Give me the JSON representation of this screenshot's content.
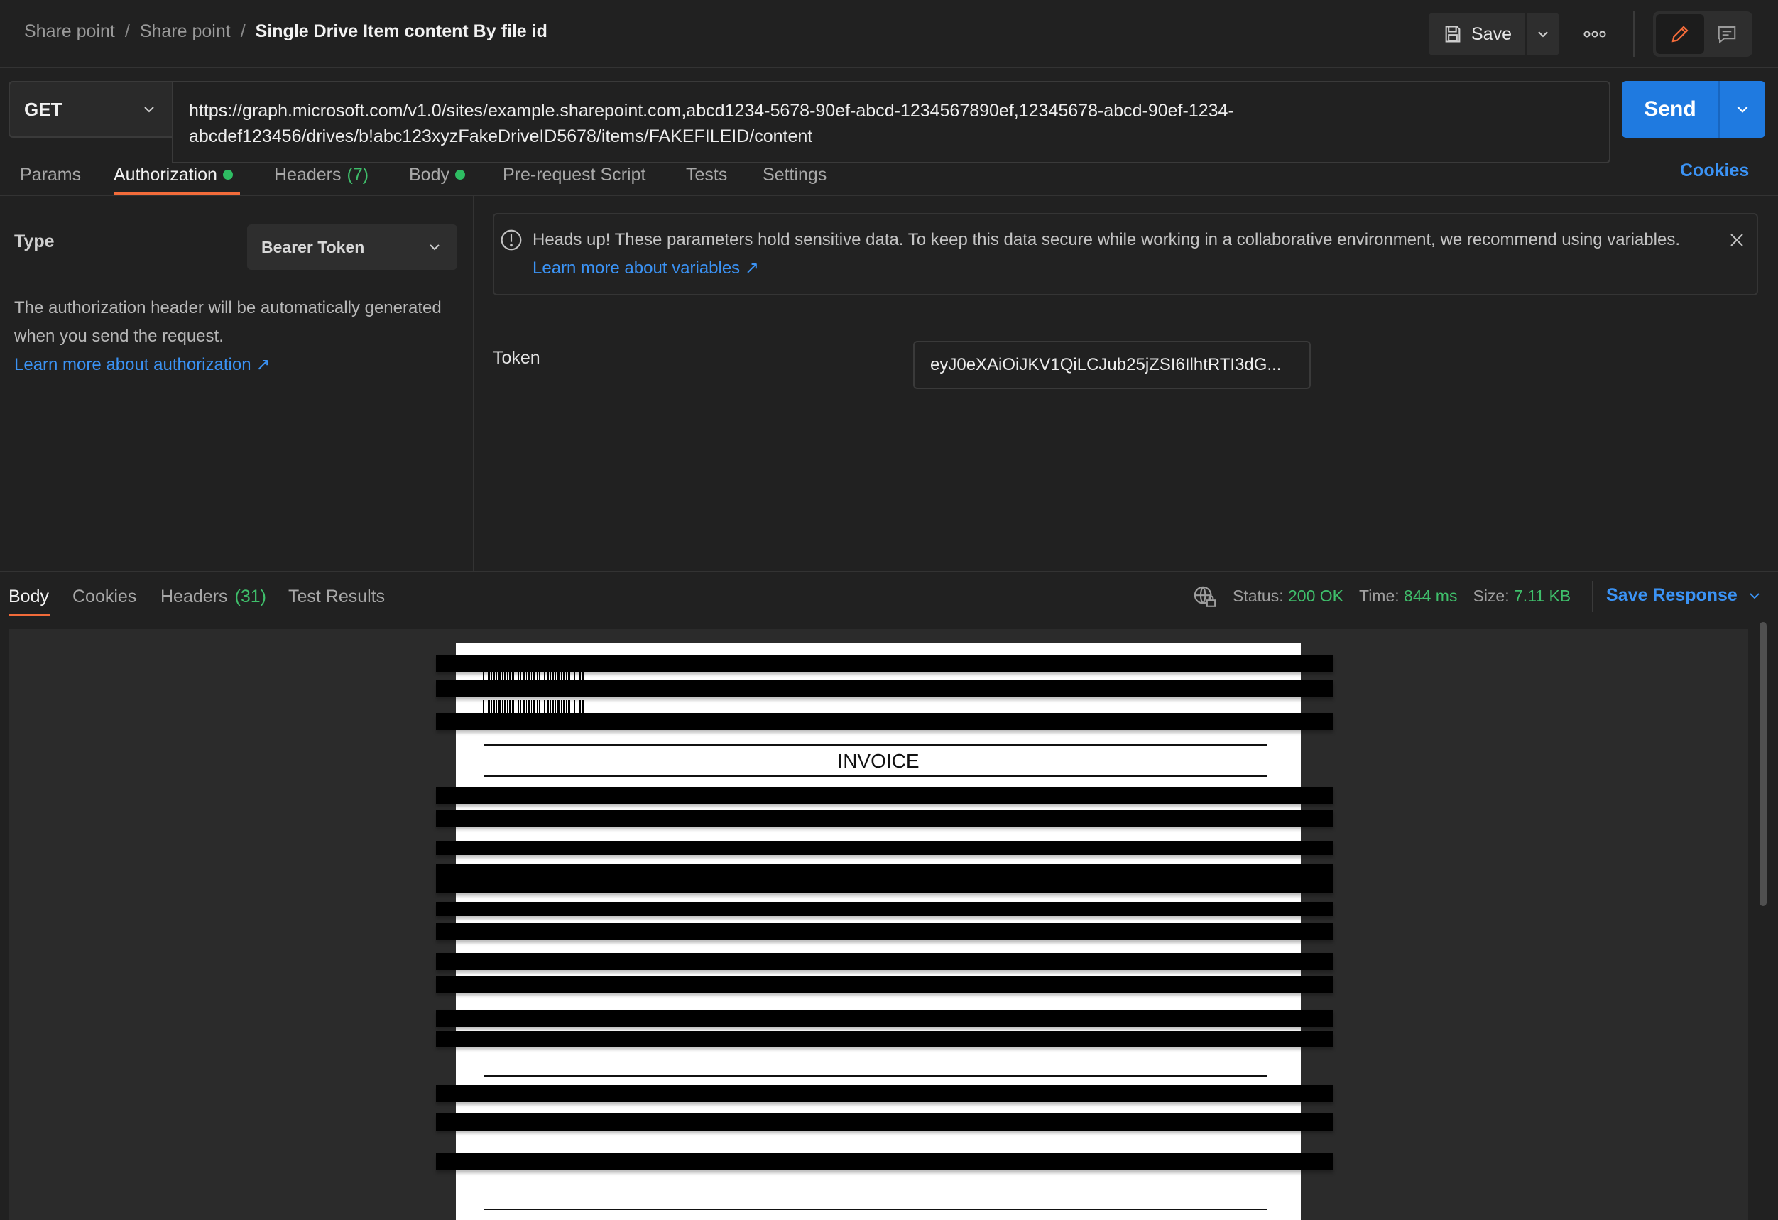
{
  "breadcrumb": {
    "items": [
      "Share point",
      "Share point"
    ],
    "separator": "/",
    "current": "Single Drive Item content By file id"
  },
  "toolbar": {
    "save_label": "Save",
    "more_icon": "more-horizontal-icon",
    "edit_icon": "pencil-icon",
    "comments_icon": "comment-icon"
  },
  "request": {
    "method": "GET",
    "url": "https://graph.microsoft.com/v1.0/sites/example.sharepoint.com,abcd1234-5678-90ef-abcd-1234567890ef,12345678-abcd-90ef-1234-abcdef123456/drives/b!abc123xyzFakeDriveID5678/items/FAKEFILEID/content",
    "send_label": "Send"
  },
  "request_tabs": {
    "params": "Params",
    "authorization": "Authorization",
    "headers": "Headers",
    "headers_count": "(7)",
    "body": "Body",
    "pre_request": "Pre-request Script",
    "tests": "Tests",
    "settings": "Settings",
    "cookies": "Cookies"
  },
  "auth": {
    "type_label": "Type",
    "type_value": "Bearer Token",
    "description": "The authorization header will be automatically generated when you send the request.",
    "learn_more": "Learn more about authorization ↗",
    "warning_text": "Heads up! These parameters hold sensitive data. To keep this data secure while working in a collaborative environment, we recommend using variables.",
    "warning_link": "Learn more about variables ↗",
    "token_label": "Token",
    "token_value": "eyJ0eXAiOiJKV1QiLCJub25jZSI6IlhtRTI3dG..."
  },
  "response_tabs": {
    "body": "Body",
    "cookies": "Cookies",
    "headers": "Headers",
    "headers_count": "(31)",
    "test_results": "Test Results"
  },
  "response_status": {
    "status_label": "Status:",
    "status_value": "200 OK",
    "time_label": "Time:",
    "time_value": "844 ms",
    "size_label": "Size:",
    "size_value": "7.11 KB",
    "save_response": "Save Response"
  },
  "invoice": {
    "title": "INVOICE"
  },
  "colors": {
    "accent": "#f26b3a",
    "primary_blue": "#1f7ae0",
    "link_blue": "#3b93f5",
    "success_green": "#3fbf6b"
  }
}
